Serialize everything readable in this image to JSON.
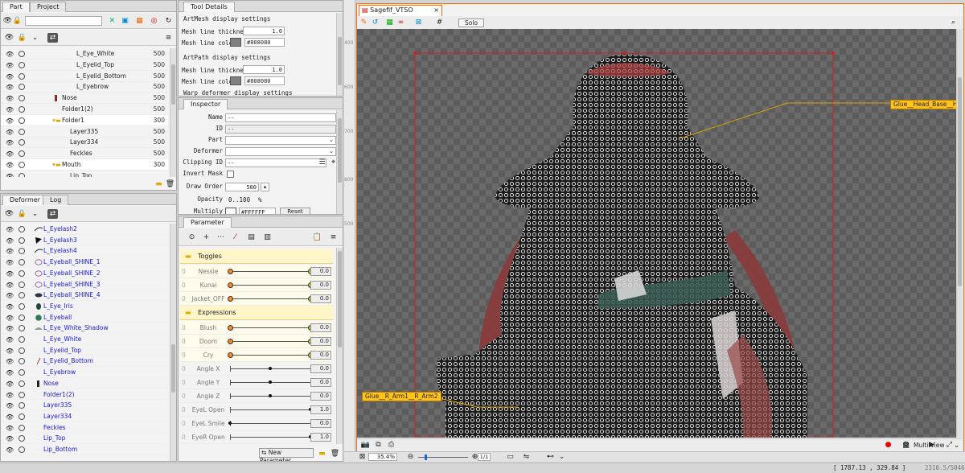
{
  "part_panel": {
    "tabs": [
      "Part",
      "Project"
    ],
    "rows": [
      {
        "name": "L_Eye_White",
        "value": "500",
        "indent": 94
      },
      {
        "name": "L_Eyelid_Top",
        "value": "500",
        "indent": 94
      },
      {
        "name": "L_Eyelid_Bottom",
        "value": "500",
        "indent": 94
      },
      {
        "name": "L_Eyebrow",
        "value": "500",
        "indent": 94
      },
      {
        "name": "Nose",
        "value": "500",
        "indent": 76
      },
      {
        "name": "Folder1(2)",
        "value": "500",
        "indent": 76
      },
      {
        "name": "Folder1",
        "value": "300",
        "indent": 76
      },
      {
        "name": "Layer335",
        "value": "500",
        "indent": 86
      },
      {
        "name": "Layer334",
        "value": "500",
        "indent": 86
      },
      {
        "name": "Feckles",
        "value": "500",
        "indent": 86
      },
      {
        "name": "Mouth",
        "value": "300",
        "indent": 76
      },
      {
        "name": "Lip_Top",
        "value": "",
        "indent": 86
      }
    ]
  },
  "tool_details": {
    "tab": "Tool Details",
    "sections": [
      {
        "title": "ArtMesh display settings",
        "thickness_label": "Mesh line thickness",
        "thickness": "1.0",
        "color_label": "Mesh line color",
        "color": "#808080"
      },
      {
        "title": "ArtPath display settings",
        "thickness_label": "Mesh line thickness",
        "thickness": "1.0",
        "color_label": "Mesh line color",
        "color": "#808080"
      }
    ],
    "cut_title": "Warp deformer display settings"
  },
  "inspector": {
    "tab": "Inspector",
    "name_label": "Name",
    "name_value": "--",
    "id_label": "ID",
    "id_value": "--",
    "part_label": "Part",
    "deformer_label": "Deformer",
    "clipping_label": "Clipping ID",
    "clipping_value": "--",
    "invert_label": "Invert Mask",
    "draw_order_label": "Draw Order",
    "draw_order_value": "500",
    "opacity_label": "Opacity",
    "opacity_value": "0..100",
    "opacity_unit": "%",
    "multiply_label": "Multiply Color",
    "multiply_value": "#FFFFFF",
    "reset_label": "Reset"
  },
  "deformer_panel": {
    "tabs": [
      "Deformer",
      "Log"
    ],
    "rows": [
      {
        "name": "L_Eyelash2",
        "glyph": "line"
      },
      {
        "name": "L_Eyelash3",
        "glyph": "tri"
      },
      {
        "name": "L_Eyelash4",
        "glyph": "line"
      },
      {
        "name": "L_Eyeball_SHINE_1",
        "glyph": "ring"
      },
      {
        "name": "L_Eyeball_SHINE_2",
        "glyph": "ring"
      },
      {
        "name": "L_Eyeball_SHINE_3",
        "glyph": "ring"
      },
      {
        "name": "L_Eyeball_SHINE_4",
        "glyph": "oval"
      },
      {
        "name": "L_Eye_Iris",
        "glyph": "iris"
      },
      {
        "name": "L_Eyeball",
        "glyph": "ball"
      },
      {
        "name": "L_Eye_White_Shadow",
        "glyph": "half"
      },
      {
        "name": "L_Eye_White",
        "glyph": "none"
      },
      {
        "name": "L_Eyelid_Top",
        "glyph": "none"
      },
      {
        "name": "L_Eyelid_Bottom",
        "glyph": "slash"
      },
      {
        "name": "L_Eyebrow",
        "glyph": "none"
      },
      {
        "name": "Nose",
        "glyph": "bar"
      },
      {
        "name": "Folder1(2)",
        "glyph": "none"
      },
      {
        "name": "Layer335",
        "glyph": "none"
      },
      {
        "name": "Layer334",
        "glyph": "none"
      },
      {
        "name": "Feckles",
        "glyph": "none"
      },
      {
        "name": "Lip_Top",
        "glyph": "none"
      },
      {
        "name": "Lip_Bottom",
        "glyph": "none"
      }
    ]
  },
  "parameter_panel": {
    "tab": "Parameter",
    "new_param_label": "New Parameter",
    "groups": [
      {
        "title": "Toggles",
        "params": [
          {
            "name": "Nessie",
            "value": "0.0",
            "knob": 1.0,
            "ends": true
          },
          {
            "name": "Kunai",
            "value": "0.0",
            "knob": 1.0,
            "ends": true
          },
          {
            "name": "Jacket_OFF",
            "value": "0.0",
            "knob": 1.0,
            "ends": true
          }
        ]
      },
      {
        "title": "Expressions",
        "params": [
          {
            "name": "Blush",
            "value": "0.0",
            "knob": 1.0,
            "ends": true
          },
          {
            "name": "Doom",
            "value": "0.0",
            "knob": 1.0,
            "ends": true
          },
          {
            "name": "Cry",
            "value": "0.0",
            "knob": 1.0,
            "ends": true
          }
        ]
      }
    ],
    "loose": [
      {
        "name": "Angle X",
        "value": "0.0",
        "knob": 0.5
      },
      {
        "name": "Angle Y",
        "value": "0.0",
        "knob": 0.5
      },
      {
        "name": "Angle Z",
        "value": "0.0",
        "knob": 0.5
      },
      {
        "name": "EyeL Open",
        "value": "1.0",
        "knob": 1.0
      },
      {
        "name": "EyeL Smile",
        "value": "0.0",
        "knob": 0.0
      },
      {
        "name": "EyeR Open",
        "value": "1.0",
        "knob": 1.0
      }
    ]
  },
  "viewport": {
    "tab": "Sagefif_VTSO",
    "solo_label": "Solo",
    "glue_head": "Glue__Head_Base__H",
    "glue_arm": "Glue__R_Arm1__R_Arm2",
    "ruler_marks": [
      "700",
      "800",
      "500",
      "600",
      "400"
    ],
    "zoom": "35.4",
    "zoom_unit": "%",
    "ratio": "1/1",
    "multi_view_label": "Multi View",
    "coords": "[ 1787.13 , 329.84 ]",
    "canvas_size": "2310.5/5046"
  },
  "colors": {
    "accent": "#ff6a00",
    "group_bg": "#fff5c8",
    "deformer_text": "#1a1acc",
    "glue_tag": "#ffc21a"
  }
}
